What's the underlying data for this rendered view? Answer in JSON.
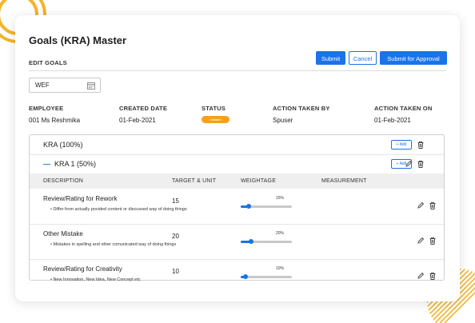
{
  "page": {
    "title": "Goals (KRA) Master",
    "section": "EDIT GOALS"
  },
  "toolbar": {
    "submit": "Submit",
    "cancel": "Cancel",
    "submit_approval": "Submit for Approval"
  },
  "wef": {
    "label": "WEF",
    "icon": "calendar-icon"
  },
  "info": {
    "headers": [
      "EMPLOYEE",
      "CREATED DATE",
      "STATUS",
      "ACTION TAKEN BY",
      "ACTION TAKEN ON"
    ],
    "employee": "001 Ms Reshmika",
    "created_date": "01-Feb-2021",
    "status": "Initiated",
    "action_by": "Spuser",
    "action_on": "01-Feb-2021"
  },
  "colors": {
    "accent": "#1a73e8",
    "status_badge": "#f4a21b",
    "deco": "#f4b42a"
  },
  "kra": {
    "label": "KRA (100%)",
    "add_label": "+ Add",
    "sub": {
      "collapse_glyph": "—",
      "label": "KRA 1 (50%)",
      "add_label": "+ Add"
    }
  },
  "table": {
    "headers": [
      "DESCRIPTION",
      "TARGET & UNIT",
      "WEIGHTAGE",
      "MEASUREMENT"
    ],
    "rows": [
      {
        "name": "Review/Rating for Rework",
        "desc": "• Differ from actually povided content or discussed way of doing things",
        "target": "15",
        "weight_label": "15%",
        "weight": 0.15
      },
      {
        "name": "Other Mistake",
        "desc": "• Mistakes in spelling and other comunicated way of doing things",
        "target": "20",
        "weight_label": "20%",
        "weight": 0.2
      },
      {
        "name": "Review/Rating for Creativity",
        "desc": "• New Innovation, New Idea, New Concept etc",
        "target": "10",
        "weight_label": "10%",
        "weight": 0.1
      }
    ]
  }
}
